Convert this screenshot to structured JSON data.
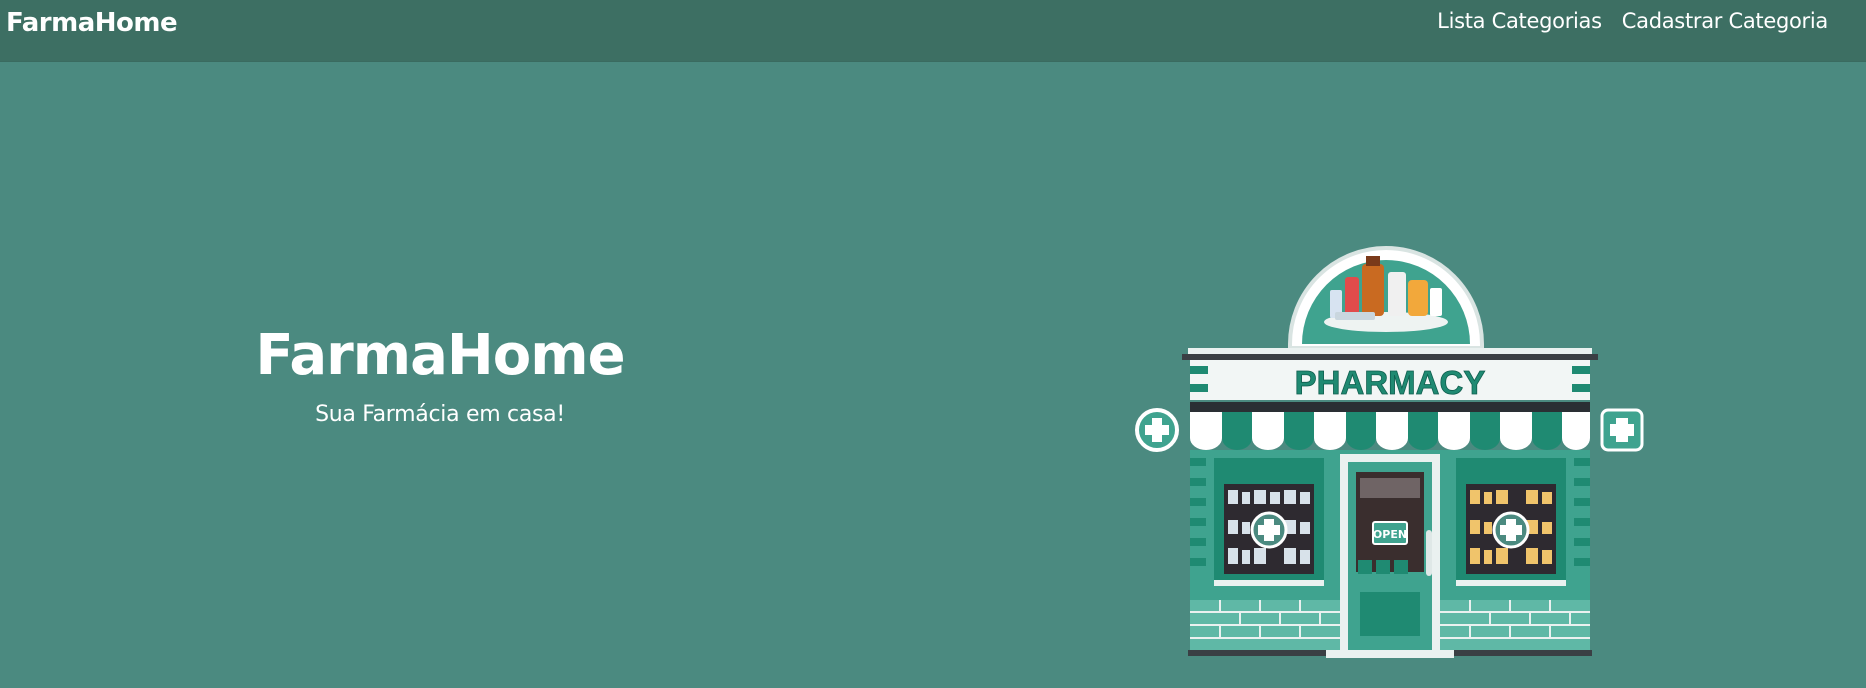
{
  "navbar": {
    "brand": "FarmaHome",
    "links": [
      {
        "label": "Lista Categorias"
      },
      {
        "label": "Cadastrar Categoria"
      }
    ]
  },
  "hero": {
    "title": "FarmaHome",
    "subtitle": "Sua Farmácia em casa!"
  },
  "illustration": {
    "sign_text": "PHARMACY",
    "door_sign": "OPEN",
    "icon": "pharmacy-storefront-illustration"
  },
  "colors": {
    "background": "#4b8a80",
    "navbar": "#3d6f63",
    "teal_dark": "#1f8a72",
    "teal_light": "#3fa38f",
    "text": "#ffffff"
  }
}
